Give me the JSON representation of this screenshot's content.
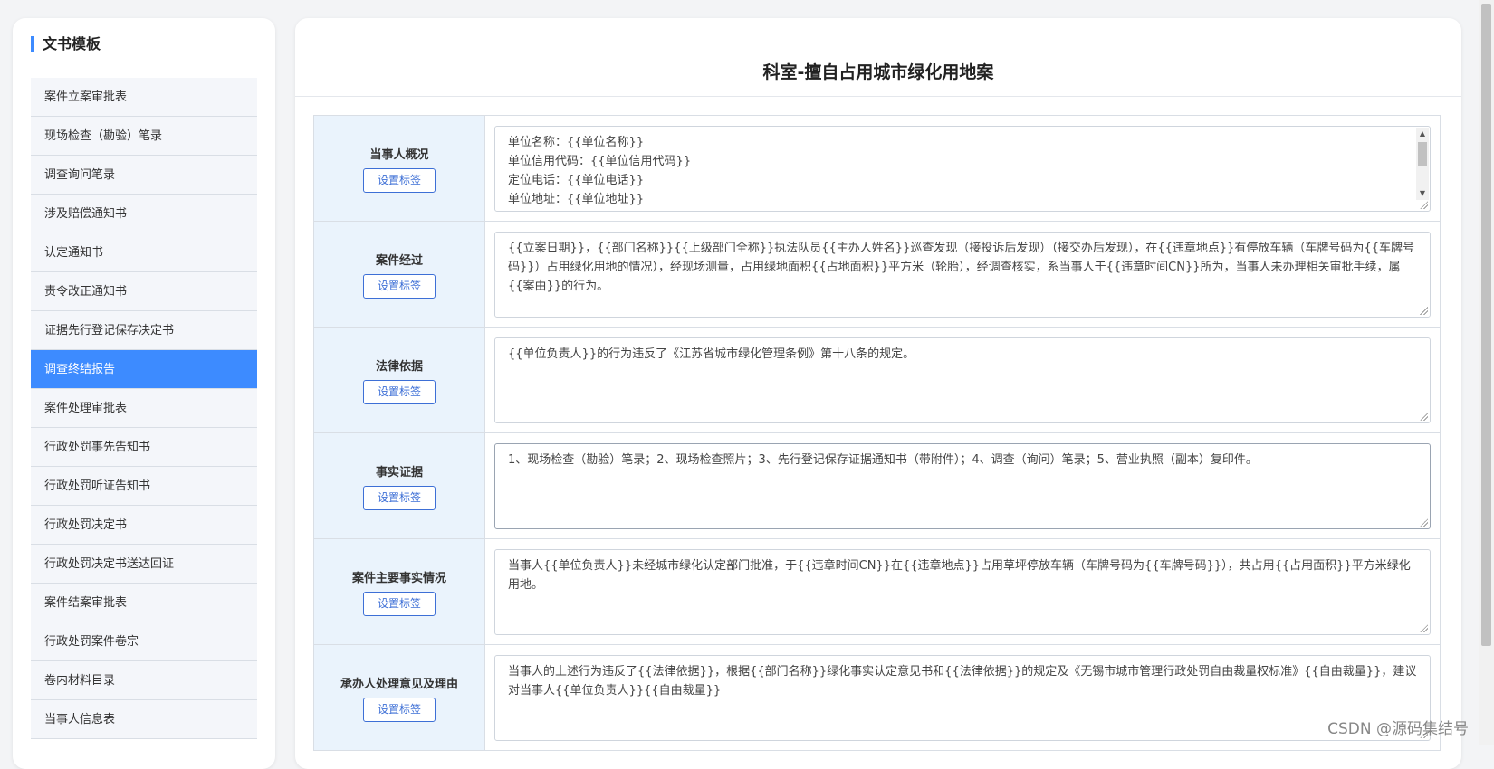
{
  "sidebar": {
    "title": "文书模板",
    "items": [
      {
        "label": "案件立案审批表"
      },
      {
        "label": "现场检查（勘验）笔录"
      },
      {
        "label": "调查询问笔录"
      },
      {
        "label": "涉及赔偿通知书"
      },
      {
        "label": "认定通知书"
      },
      {
        "label": "责令改正通知书"
      },
      {
        "label": "证据先行登记保存决定书"
      },
      {
        "label": "调查终结报告",
        "active": true
      },
      {
        "label": "案件处理审批表"
      },
      {
        "label": "行政处罚事先告知书"
      },
      {
        "label": "行政处罚听证告知书"
      },
      {
        "label": "行政处罚决定书"
      },
      {
        "label": "行政处罚决定书送达回证"
      },
      {
        "label": "案件结案审批表"
      },
      {
        "label": "行政处罚案件卷宗"
      },
      {
        "label": "卷内材料目录"
      },
      {
        "label": "当事人信息表"
      }
    ]
  },
  "main": {
    "title": "科室-擅自占用城市绿化用地案",
    "tag_button_label": "设置标签",
    "rows": [
      {
        "label": "当事人概况",
        "value": "单位名称：{{单位名称}}\n单位信用代码：{{单位信用代码}}\n定位电话：{{单位电话}}\n单位地址：{{单位地址}}\n单位负责人：{{单位负责人}}"
      },
      {
        "label": "案件经过",
        "value": "{{立案日期}}，{{部门名称}}{{上级部门全称}}执法队员{{主办人姓名}}巡查发现（接投诉后发现）（接交办后发现），在{{违章地点}}有停放车辆（车牌号码为{{车牌号码}}）占用绿化用地的情况），经现场测量，占用绿地面积{{占地面积}}平方米（轮胎），经调查核实，系当事人于{{违章时间CN}}所为，当事人未办理相关审批手续，属{{案由}}的行为。"
      },
      {
        "label": "法律依据",
        "value": "{{单位负责人}}的行为违反了《江苏省城市绿化管理条例》第十八条的规定。"
      },
      {
        "label": "事实证据",
        "value": "1、现场检查（勘验）笔录；2、现场检查照片；3、先行登记保存证据通知书（带附件）；4、调查（询问）笔录；5、营业执照（副本）复印件。"
      },
      {
        "label": "案件主要事实情况",
        "value": "当事人{{单位负责人}}未经城市绿化认定部门批准，于{{违章时间CN}}在{{违章地点}}占用草坪停放车辆（车牌号码为{{车牌号码}}），共占用{{占用面积}}平方米绿化用地。"
      },
      {
        "label": "承办人处理意见及理由",
        "value": "当事人的上述行为违反了{{法律依据}}，根据{{部门名称}}绿化事实认定意见书和{{法律依据}}的规定及《无锡市城市管理行政处罚自由裁量权标准》{{自由裁量}}，建议对当事人{{单位负责人}}{{自由裁量}}"
      }
    ]
  },
  "watermark": "CSDN @源码集结号"
}
